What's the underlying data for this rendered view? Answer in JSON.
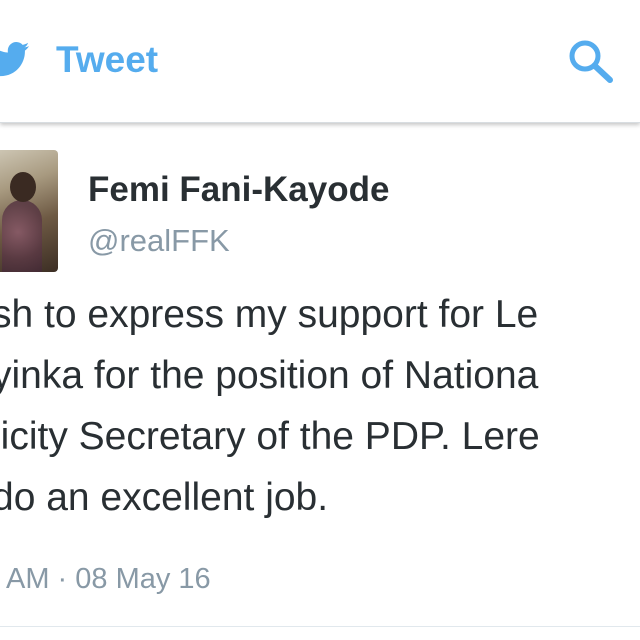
{
  "header": {
    "title": "Tweet",
    "bird_icon": "twitter-bird-icon",
    "search_icon": "search-icon"
  },
  "tweet": {
    "display_name": "Femi Fani-Kayode",
    "handle": "@realFFK",
    "text_lines": [
      "sh to express my support for Le",
      "yinka for the position of Nationa",
      "licity Secretary of the PDP.  Lere",
      " do an excellent job."
    ],
    "timestamp": "AM · 08 May 16"
  },
  "colors": {
    "accent": "#55acee",
    "text_primary": "#292f33",
    "text_secondary": "#8899a6",
    "divider": "#e1e8ed"
  }
}
